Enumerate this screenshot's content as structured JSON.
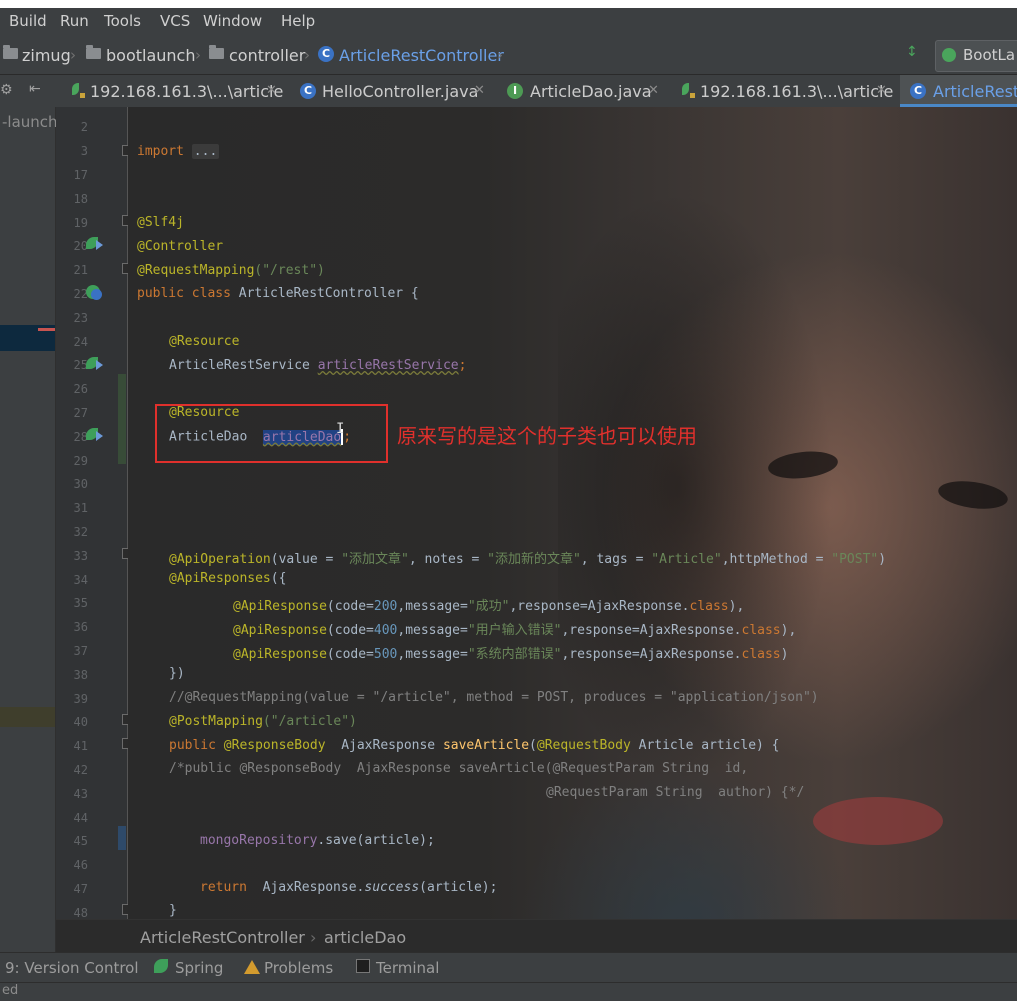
{
  "menu": [
    "Build",
    "Run",
    "Tools",
    "VCS",
    "Window",
    "Help"
  ],
  "breadcrumbs": [
    "zimug",
    "bootlaunch",
    "controller",
    "ArticleRestController"
  ],
  "run_config": "BootLa",
  "tabs": [
    {
      "label": "192.168.161.3\\...\\article",
      "icon": "mongo-leaf-icon"
    },
    {
      "label": "HelloController.java",
      "icon": "class-icon"
    },
    {
      "label": "ArticleDao.java",
      "icon": "interface-icon"
    },
    {
      "label": "192.168.161.3\\...\\article",
      "icon": "mongo-leaf-icon"
    },
    {
      "label": "ArticleRestC",
      "icon": "class-icon",
      "active": true
    }
  ],
  "left_panel_label": "-launch",
  "line_numbers": [
    "2",
    "3",
    "17",
    "18",
    "19",
    "20",
    "21",
    "22",
    "23",
    "24",
    "25",
    "26",
    "27",
    "28",
    "29",
    "30",
    "31",
    "32",
    "33",
    "34",
    "35",
    "36",
    "37",
    "38",
    "39",
    "40",
    "41",
    "42",
    "43",
    "44",
    "45",
    "46",
    "47",
    "48"
  ],
  "code": {
    "import_kw": "import",
    "import_fold": "...",
    "ann_slf4j": "@Slf4j",
    "ann_controller": "@Controller",
    "ann_reqmap": "@RequestMapping",
    "reqmap_val": "(\"/rest\")",
    "class_kw": "public class",
    "class_name": " ArticleRestController {",
    "ann_resource": "@Resource",
    "svc_type": "ArticleRestService ",
    "svc_field": "articleRestService",
    "semicolon": ";",
    "dao_type": "ArticleDao  ",
    "dao_field": "articleDao",
    "apiop": "@ApiOperation",
    "apiop_p1": "(value = ",
    "apiop_v1": "\"添加文章\"",
    "apiop_p2": ", notes = ",
    "apiop_v2": "\"添加新的文章\"",
    "apiop_p3": ", tags = ",
    "apiop_v3": "\"Article\"",
    "apiop_p4": ",httpMethod = ",
    "apiop_v4": "\"POST\"",
    "apiop_p5": ")",
    "apiresps": "@ApiResponses",
    "apiresps_open": "({",
    "resp": "@ApiResponse",
    "code_open": "(code=",
    "codes": [
      "200",
      "400",
      "500"
    ],
    "msg_kw": ",message=",
    "msgs": [
      "\"成功\"",
      "\"用户输入错误\"",
      "\"系统内部错误\""
    ],
    "resp_kw": ",response=AjaxResponse.",
    "class_kw2": "class",
    "resp_close": "),",
    "resp_close_last": ")",
    "close_brace": "})",
    "comment_line": "//@RequestMapping(value = \"/article\", method = POST, produces = \"application/json\")",
    "postmap": "@PostMapping",
    "postmap_val": "(\"/article\")",
    "public_kw": "public ",
    "respbody": "@ResponseBody",
    "method_mid": "  AjaxResponse ",
    "method_name": "saveArticle",
    "paren": "(",
    "reqbody": "@RequestBody",
    "method_tail": " Article article) {",
    "comment2": "/*public @ResponseBody  AjaxResponse saveArticle(@RequestParam String  id,",
    "comment3": "@RequestParam String  author) {*/",
    "mongo_field": "mongoRepository",
    "mongo_call": ".save(article);",
    "return_kw": "return",
    "return_mid": "  AjaxResponse.",
    "return_method": "success",
    "return_tail": "(article);",
    "end_brace": "}"
  },
  "annotation_note": "原来写的是这个的子类也可以使用",
  "editor_breadcrumb": [
    "ArticleRestController",
    "articleDao"
  ],
  "bottom_tools": [
    "9: Version Control",
    "Spring",
    "Problems",
    "Terminal"
  ],
  "status_text": "ed",
  "colors": {
    "keyword": "#cc7832",
    "annotation": "#bbb529",
    "string": "#6a8759",
    "number": "#6897bb",
    "field": "#9876aa",
    "annotation_box": "#e0302c"
  }
}
